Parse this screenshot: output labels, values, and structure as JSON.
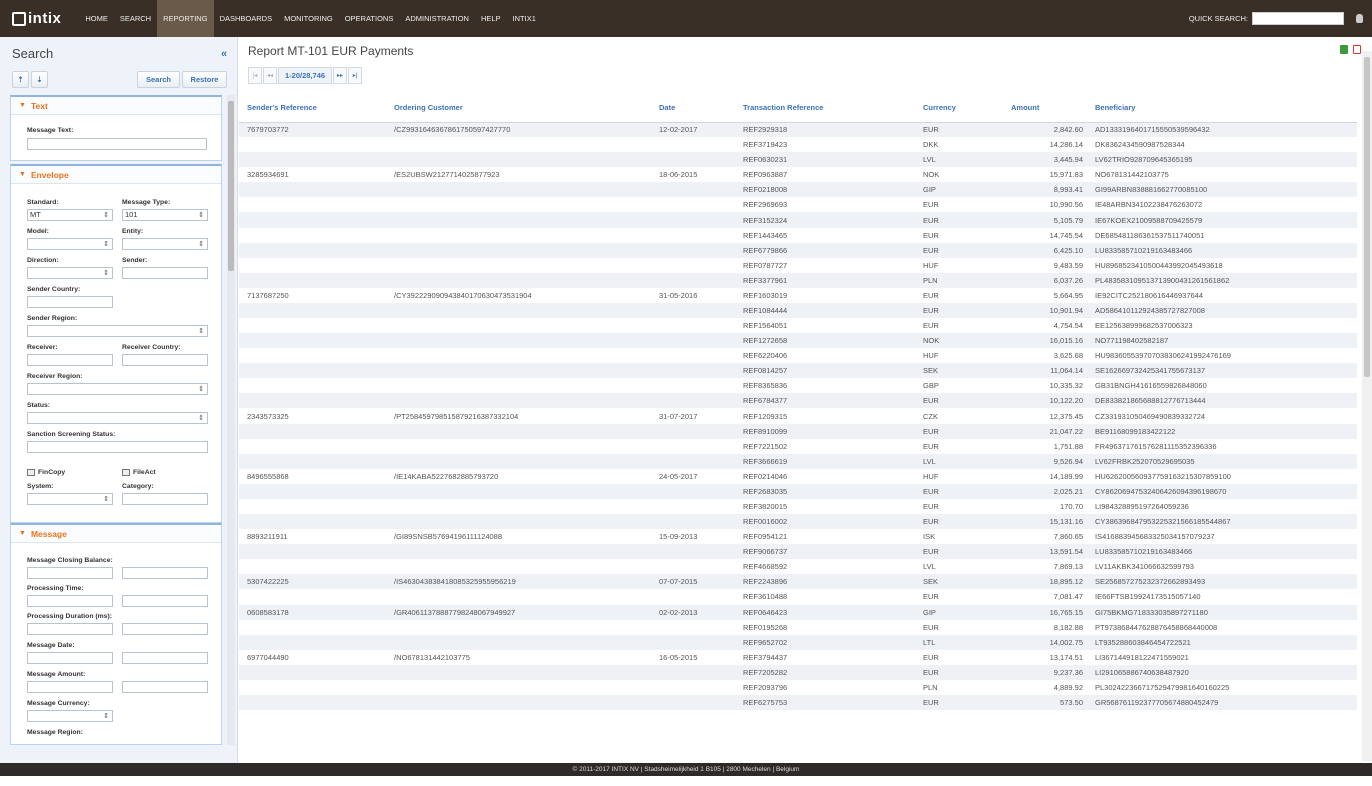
{
  "brand": {
    "logo_text": "intix"
  },
  "nav": [
    {
      "label": "HOME",
      "active": false
    },
    {
      "label": "SEARCH",
      "active": false
    },
    {
      "label": "REPORTING",
      "active": true
    },
    {
      "label": "DASHBOARDS",
      "active": false
    },
    {
      "label": "MONITORING",
      "active": false
    },
    {
      "label": "OPERATIONS",
      "active": false
    },
    {
      "label": "ADMINISTRATION",
      "active": false
    },
    {
      "label": "HELP",
      "active": false
    },
    {
      "label": "INTIX1",
      "active": false
    }
  ],
  "quick_search": {
    "label": "QUICK SEARCH:",
    "value": ""
  },
  "search_panel": {
    "title": "Search",
    "search_button": "Search",
    "restore_button": "Restore",
    "text_section": {
      "title": "Text",
      "message_text_label": "Message Text:"
    },
    "envelope_section": {
      "title": "Envelope",
      "standard_label": "Standard:",
      "standard_value": "MT",
      "message_type_label": "Message Type:",
      "message_type_value": "101",
      "model_label": "Model:",
      "entity_label": "Entity:",
      "direction_label": "Direction:",
      "sender_label": "Sender:",
      "sender_country_label": "Sender Country:",
      "sender_region_label": "Sender Region:",
      "receiver_label": "Receiver:",
      "receiver_country_label": "Receiver Country:",
      "receiver_region_label": "Receiver Region:",
      "status_label": "Status:",
      "sanction_label": "Sanction Screening Status:",
      "fincopy_label": "FinCopy",
      "fileact_label": "FileAct",
      "system_label": "System:",
      "category_label": "Category:"
    },
    "message_section": {
      "title": "Message",
      "closing_balance_label": "Message Closing Balance:",
      "processing_time_label": "Processing Time:",
      "processing_duration_label": "Processing Duration (ms):",
      "message_date_label": "Message Date:",
      "message_amount_label": "Message Amount:",
      "message_currency_label": "Message Currency:",
      "message_region_label": "Message Region:"
    }
  },
  "report": {
    "title": "Report MT-101 EUR Payments",
    "pager_info": "1-20/28,746",
    "columns": [
      "Sender's Reference",
      "Ordering Customer",
      "Date",
      "Transaction Reference",
      "Currency",
      "Amount",
      "Beneficiary"
    ],
    "rows": [
      [
        "7679703772",
        "/CZ9931646367861750597427770",
        "12-02-2017",
        "REF2929318",
        "EUR",
        "2,842.60",
        "AD1333196401715550539596432"
      ],
      [
        "",
        "",
        "",
        "REF3719423",
        "DKK",
        "14,286.14",
        "DK8362434590987528344"
      ],
      [
        "",
        "",
        "",
        "REF0630231",
        "LVL",
        "3,445.94",
        "LV62TRIO928709645365195"
      ],
      [
        "3285934691",
        "/ES2UBSW2127714025877923",
        "18-06-2015",
        "REF0963887",
        "NOK",
        "15,971.83",
        "NO678131442103775"
      ],
      [
        "",
        "",
        "",
        "REF0218008",
        "GIP",
        "8,993.41",
        "GI99ARBN838881662770085100"
      ],
      [
        "",
        "",
        "",
        "REF2969693",
        "EUR",
        "10,990.56",
        "IE48ARBN34102238476263072"
      ],
      [
        "",
        "",
        "",
        "REF3152324",
        "EUR",
        "5,105.79",
        "IE67KOEX21009588709425579"
      ],
      [
        "",
        "",
        "",
        "REF1443465",
        "EUR",
        "14,745.54",
        "DE685481186361537511740051"
      ],
      [
        "",
        "",
        "",
        "REF6779866",
        "EUR",
        "6,425.10",
        "LU833585710219163483466"
      ],
      [
        "",
        "",
        "",
        "REF0787727",
        "HUF",
        "9,483.59",
        "HU8968523410500443992045493618"
      ],
      [
        "",
        "",
        "",
        "REF3377961",
        "PLN",
        "6,037.26",
        "PL483583109513713900431261561862"
      ],
      [
        "7137687250",
        "/CY392229090943840170630473531904",
        "31-05-2016",
        "REF1603019",
        "EUR",
        "5,664.95",
        "IE92CITC252180616446937644"
      ],
      [
        "",
        "",
        "",
        "REF1084444",
        "EUR",
        "10,901.94",
        "AD586410112924385727827008"
      ],
      [
        "",
        "",
        "",
        "REF1564051",
        "EUR",
        "4,754.54",
        "EE125638999682537006323"
      ],
      [
        "",
        "",
        "",
        "REF1272658",
        "NOK",
        "16,015.16",
        "NO771198402582187"
      ],
      [
        "",
        "",
        "",
        "REF6220406",
        "HUF",
        "3,625.68",
        "HU983605539707038306241992476169"
      ],
      [
        "",
        "",
        "",
        "REF0814257",
        "SEK",
        "11,064.14",
        "SE162669732425341755673137"
      ],
      [
        "",
        "",
        "",
        "REF8365836",
        "GBP",
        "10,335.32",
        "GB31BNGH41616559826848060"
      ],
      [
        "",
        "",
        "",
        "REF6784377",
        "EUR",
        "10,122.20",
        "DE833821865688812776713444"
      ],
      [
        "2343573325",
        "/PT258459798515879216387332104",
        "31-07-2017",
        "REF1209315",
        "CZK",
        "12,375.45",
        "CZ331931050469490839332724"
      ],
      [
        "",
        "",
        "",
        "REF8910099",
        "EUR",
        "21,047.22",
        "BE91168099183422122"
      ],
      [
        "",
        "",
        "",
        "REF7221502",
        "EUR",
        "1,751.88",
        "FR496371761576281115352396336"
      ],
      [
        "",
        "",
        "",
        "REF3666619",
        "LVL",
        "9,526.94",
        "LV62FRBK252070529695035"
      ],
      [
        "8496555868",
        "/IE14KABA5227682885793720",
        "24-05-2017",
        "REF0214046",
        "HUF",
        "14,189.99",
        "HU626200560937759163215307859100"
      ],
      [
        "",
        "",
        "",
        "REF2683035",
        "EUR",
        "2,025.21",
        "CY86206947532406426094396198670"
      ],
      [
        "",
        "",
        "",
        "REF3820015",
        "EUR",
        "170.70",
        "LI984328895197264059236"
      ],
      [
        "",
        "",
        "",
        "REF0016002",
        "EUR",
        "15,131.16",
        "CY386396847953225321566185544867"
      ],
      [
        "8893211911",
        "/GI89SNSB57694196111124088",
        "15-09-2013",
        "REF0954121",
        "ISK",
        "7,860.65",
        "IS416883945683325034157079237"
      ],
      [
        "",
        "",
        "",
        "REF9066737",
        "EUR",
        "13,591.54",
        "LU833585710219163483466"
      ],
      [
        "",
        "",
        "",
        "REF4668592",
        "LVL",
        "7,869.13",
        "LV11AKBK341066632599793"
      ],
      [
        "5307422225",
        "/IS463043838418085325955956219",
        "07-07-2015",
        "REF2243896",
        "SEK",
        "18,895.12",
        "SE256857275232372662893493"
      ],
      [
        "",
        "",
        "",
        "REF3610488",
        "EUR",
        "7,081.47",
        "IE66FTSB19924173515057140"
      ],
      [
        "0608583178",
        "/GR40611378887798248067949927",
        "02-02-2013",
        "REF0646423",
        "GIP",
        "16,765.15",
        "GI75BKMG718333035897271180"
      ],
      [
        "",
        "",
        "",
        "REF0195268",
        "EUR",
        "8,182.88",
        "PT973868447628876458868440008"
      ],
      [
        "",
        "",
        "",
        "REF9652702",
        "LTL",
        "14,002.75",
        "LT935288603846454722521"
      ],
      [
        "6977044490",
        "/NO678131442103775",
        "16-05-2015",
        "REF3794437",
        "EUR",
        "13,174.51",
        "LI367144918122471559021"
      ],
      [
        "",
        "",
        "",
        "REF7205282",
        "EUR",
        "9,237.36",
        "LI291065886740638487920"
      ],
      [
        "",
        "",
        "",
        "REF2093796",
        "PLN",
        "4,889.92",
        "PL302422366717529479981640160225"
      ],
      [
        "",
        "",
        "",
        "REF6275753",
        "EUR",
        "573.50",
        "GR568761192377705674880452479"
      ]
    ]
  },
  "footer": {
    "text": "© 2011-2017 INTIX NV | Stadsheimelijkheid 1 B105 | 2800 Mechelen | Belgium"
  }
}
